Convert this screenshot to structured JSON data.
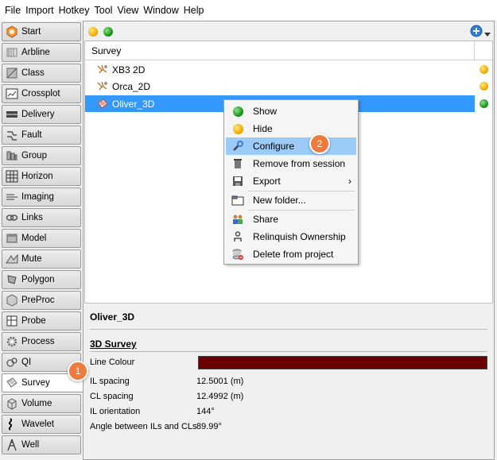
{
  "menubar": {
    "items": [
      {
        "label": "File"
      },
      {
        "label": "Import"
      },
      {
        "label": "Hotkey"
      },
      {
        "label": "Tool"
      },
      {
        "label": "View"
      },
      {
        "label": "Window"
      },
      {
        "label": "Help"
      }
    ]
  },
  "sidebar": {
    "items": [
      {
        "label": "Start",
        "icon": "start-icon"
      },
      {
        "label": "Arbline",
        "icon": "arbline-icon"
      },
      {
        "label": "Class",
        "icon": "class-icon"
      },
      {
        "label": "Crossplot",
        "icon": "crossplot-icon"
      },
      {
        "label": "Delivery",
        "icon": "delivery-icon"
      },
      {
        "label": "Fault",
        "icon": "fault-icon"
      },
      {
        "label": "Group",
        "icon": "group-icon"
      },
      {
        "label": "Horizon",
        "icon": "horizon-icon"
      },
      {
        "label": "Imaging",
        "icon": "imaging-icon"
      },
      {
        "label": "Links",
        "icon": "links-icon"
      },
      {
        "label": "Model",
        "icon": "model-icon"
      },
      {
        "label": "Mute",
        "icon": "mute-icon"
      },
      {
        "label": "Polygon",
        "icon": "polygon-icon"
      },
      {
        "label": "PreProc",
        "icon": "preproc-icon"
      },
      {
        "label": "Probe",
        "icon": "probe-icon"
      },
      {
        "label": "Process",
        "icon": "process-icon"
      },
      {
        "label": "QI",
        "icon": "qi-icon"
      },
      {
        "label": "Survey",
        "icon": "survey-icon",
        "active": true
      },
      {
        "label": "Volume",
        "icon": "volume-icon"
      },
      {
        "label": "Wavelet",
        "icon": "wavelet-icon"
      },
      {
        "label": "Well",
        "icon": "well-icon"
      }
    ]
  },
  "list": {
    "column_header": "Survey",
    "rows": [
      {
        "name": "XB3 2D",
        "status": "yellow",
        "icon": "survey-2d-icon"
      },
      {
        "name": "Orca_2D",
        "status": "yellow",
        "icon": "survey-2d-icon"
      },
      {
        "name": "Oliver_3D",
        "status": "green",
        "icon": "survey-3d-icon",
        "selected": true
      }
    ]
  },
  "context_menu": {
    "items": [
      {
        "label": "Show",
        "icon": "green-dot-icon"
      },
      {
        "label": "Hide",
        "icon": "yellow-dot-icon"
      },
      {
        "label": "Configure",
        "icon": "wrench-icon",
        "highlighted": true
      },
      {
        "label": "Remove from session",
        "icon": "trash-icon"
      },
      {
        "label": "Export",
        "icon": "save-icon",
        "submenu": true
      },
      {
        "label": "New folder...",
        "icon": "folder-icon"
      },
      {
        "label": "Share",
        "icon": "users-icon"
      },
      {
        "label": "Relinquish Ownership",
        "icon": "user-icon"
      },
      {
        "label": "Delete from project",
        "icon": "delete-db-icon"
      }
    ],
    "submenu_arrow": "›"
  },
  "details": {
    "title": "Oliver_3D",
    "subtitle": "3D Survey",
    "line_colour_label": "Line Colour",
    "line_colour": "#6a0000",
    "rows": [
      {
        "label": "IL spacing",
        "value": "12.5001 (m)"
      },
      {
        "label": "CL spacing",
        "value": "12.4992 (m)"
      },
      {
        "label": "IL orientation",
        "value": "144°"
      },
      {
        "label": "Angle between ILs and CLs",
        "value": "89.99°"
      }
    ]
  },
  "callouts": [
    {
      "number": "1"
    },
    {
      "number": "2"
    }
  ],
  "colors": {
    "selection": "#3399ff",
    "menu_highlight": "#9ccbf7",
    "callout": "#ee7a3d",
    "status_yellow": "#f0b000",
    "status_green": "#1a9a1a"
  }
}
